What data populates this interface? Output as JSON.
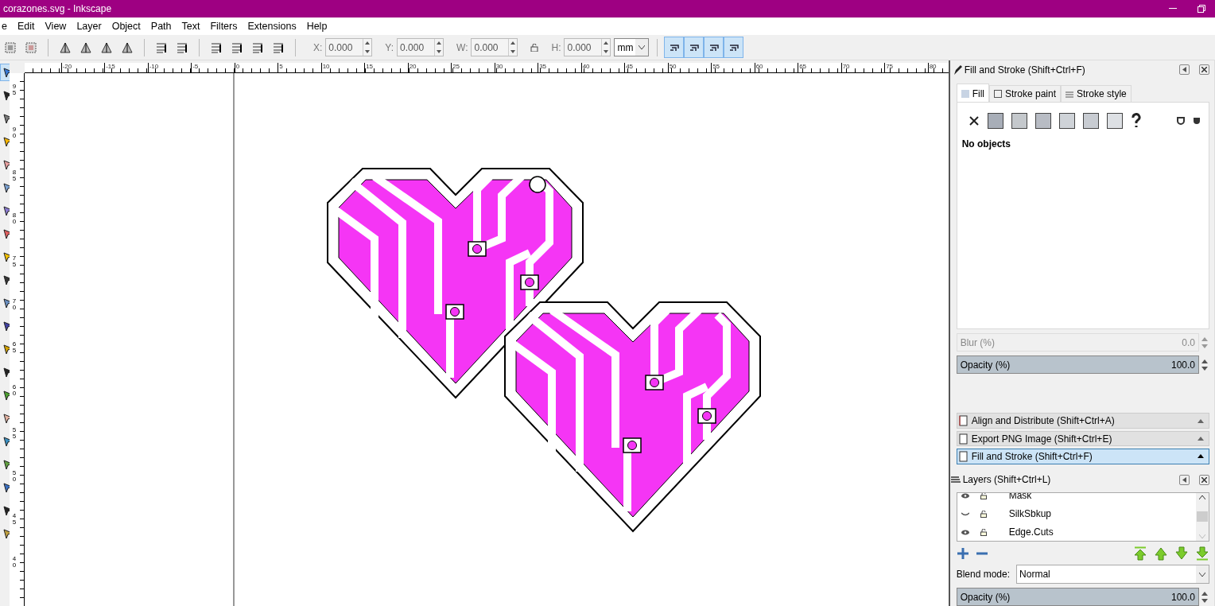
{
  "window": {
    "title": "corazones.svg - Inkscape"
  },
  "menu": [
    "e",
    "Edit",
    "View",
    "Layer",
    "Object",
    "Path",
    "Text",
    "Filters",
    "Extensions",
    "Help"
  ],
  "toolbox": [
    {
      "selected": true
    },
    {
      "selected": false
    },
    {
      "selected": false
    },
    {
      "selected": false
    },
    {
      "selected": false
    },
    {
      "selected": false
    },
    {
      "selected": false
    },
    {
      "selected": false
    },
    {
      "selected": false
    },
    {
      "selected": false
    },
    {
      "selected": false
    },
    {
      "selected": false
    },
    {
      "selected": false
    },
    {
      "selected": false
    },
    {
      "selected": false
    },
    {
      "selected": false
    },
    {
      "selected": false
    },
    {
      "selected": false
    },
    {
      "selected": false
    },
    {
      "selected": false
    },
    {
      "selected": false
    }
  ],
  "toolbar": {
    "fields": [
      {
        "label": "X:",
        "value": "0.000"
      },
      {
        "label": "Y:",
        "value": "0.000"
      },
      {
        "label": "W:",
        "value": "0.000"
      },
      {
        "label": "H:",
        "value": "0.000"
      }
    ],
    "unit": "mm",
    "snap_buttons": [
      {
        "on": true
      },
      {
        "on": true
      },
      {
        "on": true
      },
      {
        "on": true
      }
    ]
  },
  "rulers": {
    "horizontal": [
      "-20",
      "-15",
      "-10",
      "-5",
      "0",
      "5",
      "10",
      "15",
      "20",
      "25",
      "30",
      "35",
      "40",
      "45",
      "50",
      "55",
      "60",
      "65",
      "70",
      "75",
      "80"
    ],
    "vertical": [
      "95",
      "90",
      "85",
      "80",
      "75",
      "70",
      "65",
      "60",
      "55",
      "50",
      "45",
      "40"
    ]
  },
  "fill_stroke": {
    "title": "Fill and Stroke (Shift+Ctrl+F)",
    "tabs": [
      {
        "label": "Fill",
        "selected": true
      },
      {
        "label": "Stroke paint",
        "selected": false
      },
      {
        "label": "Stroke style",
        "selected": false
      }
    ],
    "message": "No objects",
    "blur": {
      "label": "Blur (%)",
      "value": "0.0",
      "disabled": true
    },
    "opacity": {
      "label": "Opacity (%)",
      "value": "100.0",
      "level": 1
    }
  },
  "docked": [
    {
      "title": "Align and Distribute (Shift+Ctrl+A)",
      "selected": false
    },
    {
      "title": "Export PNG Image (Shift+Ctrl+E)",
      "selected": false
    },
    {
      "title": "Fill and Stroke (Shift+Ctrl+F)",
      "selected": true
    }
  ],
  "layers": {
    "title": "Layers (Shift+Ctrl+L)",
    "rows": [
      {
        "name": "Mask",
        "visible": true
      },
      {
        "name": "SilkSbkup",
        "visible": false
      },
      {
        "name": "Edge.Cuts",
        "visible": true
      }
    ],
    "blend_label": "Blend mode:",
    "blend_mode": "Normal",
    "opacity": {
      "label": "Opacity (%)",
      "value": "100.0",
      "level": 1
    }
  }
}
